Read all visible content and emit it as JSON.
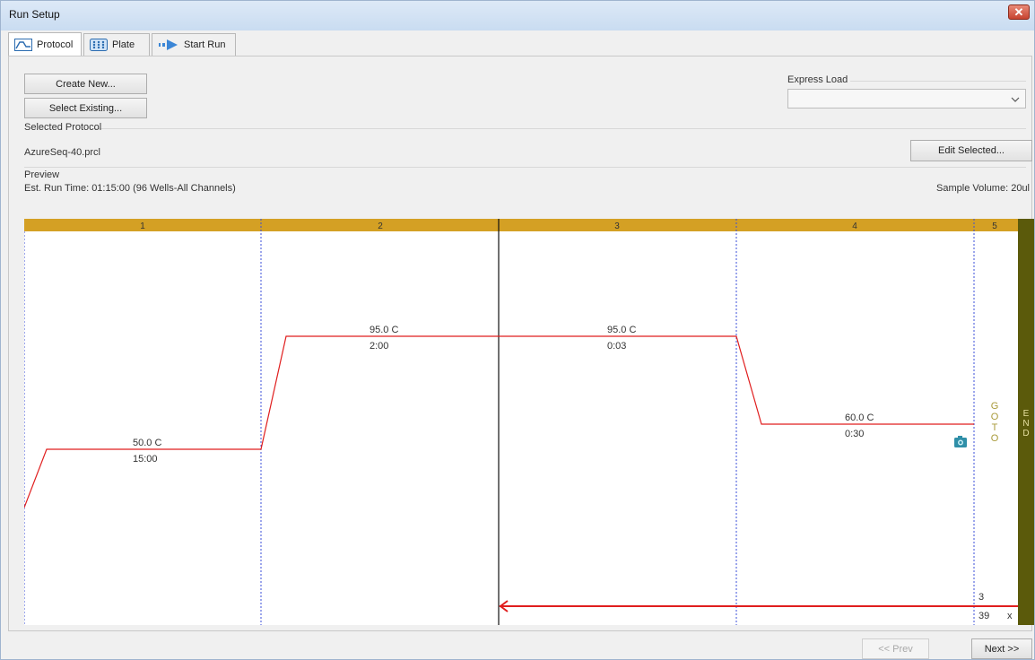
{
  "window": {
    "title": "Run Setup",
    "close_label": "✕"
  },
  "tabs": [
    {
      "label": "Protocol",
      "icon": "protocol-graph-icon",
      "active": true
    },
    {
      "label": "Plate",
      "icon": "plate-grid-icon",
      "active": false
    },
    {
      "label": "Start Run",
      "icon": "start-run-arrow-icon",
      "active": false
    }
  ],
  "actions": {
    "create_new": "Create New...",
    "select_existing": "Select Existing..."
  },
  "express_load": {
    "label": "Express Load",
    "value": ""
  },
  "selected_protocol": {
    "heading": "Selected Protocol",
    "file": "AzureSeq-40.prcl",
    "edit_button": "Edit Selected..."
  },
  "preview": {
    "heading": "Preview",
    "run_time": "Est. Run Time:  01:15:00   (96 Wells-All Channels)",
    "sample_volume": "Sample Volume:  20ul"
  },
  "protocol_chart": {
    "steps": [
      {
        "number": "1",
        "temp": "50.0  C",
        "time": "15:00",
        "temp_value": 50.0
      },
      {
        "number": "2",
        "temp": "95.0  C",
        "time": "2:00",
        "temp_value": 95.0
      },
      {
        "number": "3",
        "temp": "95.0  C",
        "time": "0:03",
        "temp_value": 95.0
      },
      {
        "number": "4",
        "temp": "60.0  C",
        "time": "0:30",
        "temp_value": 60.0,
        "capture": true
      },
      {
        "number": "5",
        "goto_letters": [
          "G",
          "O",
          "T",
          "O"
        ],
        "goto_step": "3",
        "repeat": "39",
        "repeat_suffix": "x"
      }
    ],
    "end_letters": [
      "E",
      "N",
      "D"
    ],
    "colors": {
      "header": "#d4a024",
      "end_bar": "#5b5a0b",
      "trace": "#e01e1e",
      "divider": "#3b4fd8",
      "goto_text": "#a99a3a"
    }
  },
  "footer": {
    "prev": "<< Prev",
    "next": "Next >>"
  }
}
